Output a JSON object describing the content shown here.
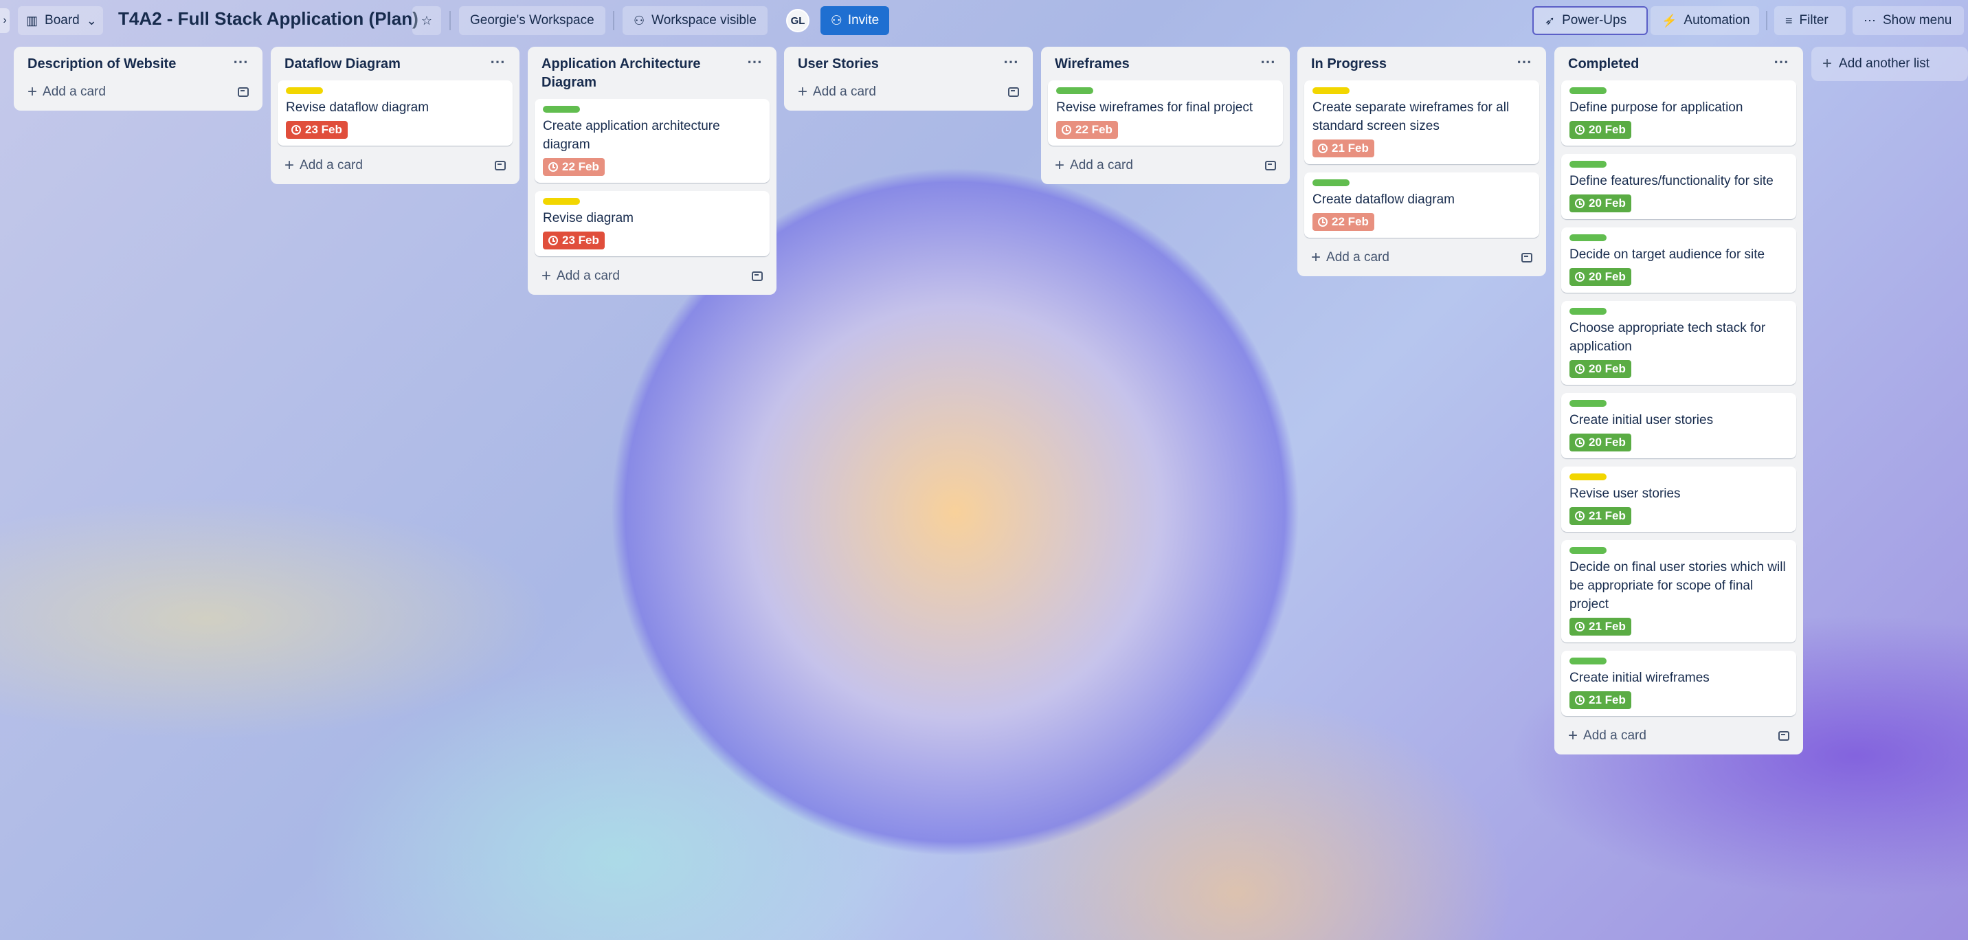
{
  "header": {
    "view_label": "Board",
    "title": "T4A2 - Full Stack Application (Plan)",
    "workspace_label": "Georgie's Workspace",
    "visibility_label": "Workspace visible",
    "avatar_initials": "GL",
    "invite_label": "Invite",
    "powerups_label": "Power-Ups",
    "automation_label": "Automation",
    "filter_label": "Filter",
    "show_menu_label": "Show menu"
  },
  "add_card_label": "Add a card",
  "add_list_label": "Add another list",
  "colors": {
    "label_green": "#61bd4f",
    "label_yellow": "#f2d600",
    "badge_green": "#5aac44",
    "badge_red": "#e04e3b",
    "badge_pink": "#e8907f"
  },
  "lists": [
    {
      "title": "Description of Website",
      "cards": []
    },
    {
      "title": "Dataflow Diagram",
      "cards": [
        {
          "title": "Revise dataflow diagram",
          "label": "yellow",
          "date": "23 Feb",
          "status": "red"
        }
      ]
    },
    {
      "title": "Application Architecture Diagram",
      "cards": [
        {
          "title": "Create application architecture diagram",
          "label": "green",
          "date": "22 Feb",
          "status": "pink"
        },
        {
          "title": "Revise diagram",
          "label": "yellow",
          "date": "23 Feb",
          "status": "red"
        }
      ]
    },
    {
      "title": "User Stories",
      "cards": []
    },
    {
      "title": "Wireframes",
      "cards": [
        {
          "title": "Revise wireframes for final project",
          "label": "green",
          "date": "22 Feb",
          "status": "pink"
        }
      ]
    },
    {
      "title": "In Progress",
      "cards": [
        {
          "title": "Create separate wireframes for all standard screen sizes",
          "label": "yellow",
          "date": "21 Feb",
          "status": "pink"
        },
        {
          "title": "Create dataflow diagram",
          "label": "green",
          "date": "22 Feb",
          "status": "pink"
        }
      ]
    },
    {
      "title": "Completed",
      "cards": [
        {
          "title": "Define purpose for application",
          "label": "green",
          "date": "20 Feb",
          "status": "green"
        },
        {
          "title": "Define features/functionality for site",
          "label": "green",
          "date": "20 Feb",
          "status": "green"
        },
        {
          "title": "Decide on target audience for site",
          "label": "green",
          "date": "20 Feb",
          "status": "green"
        },
        {
          "title": "Choose appropriate tech stack for application",
          "label": "green",
          "date": "20 Feb",
          "status": "green"
        },
        {
          "title": "Create initial user stories",
          "label": "green",
          "date": "20 Feb",
          "status": "green"
        },
        {
          "title": "Revise user stories",
          "label": "yellow",
          "date": "21 Feb",
          "status": "green"
        },
        {
          "title": "Decide on final user stories which will be appropriate for scope of final project",
          "label": "green",
          "date": "21 Feb",
          "status": "green"
        },
        {
          "title": "Create initial wireframes",
          "label": "green",
          "date": "21 Feb",
          "status": "green"
        }
      ]
    }
  ]
}
